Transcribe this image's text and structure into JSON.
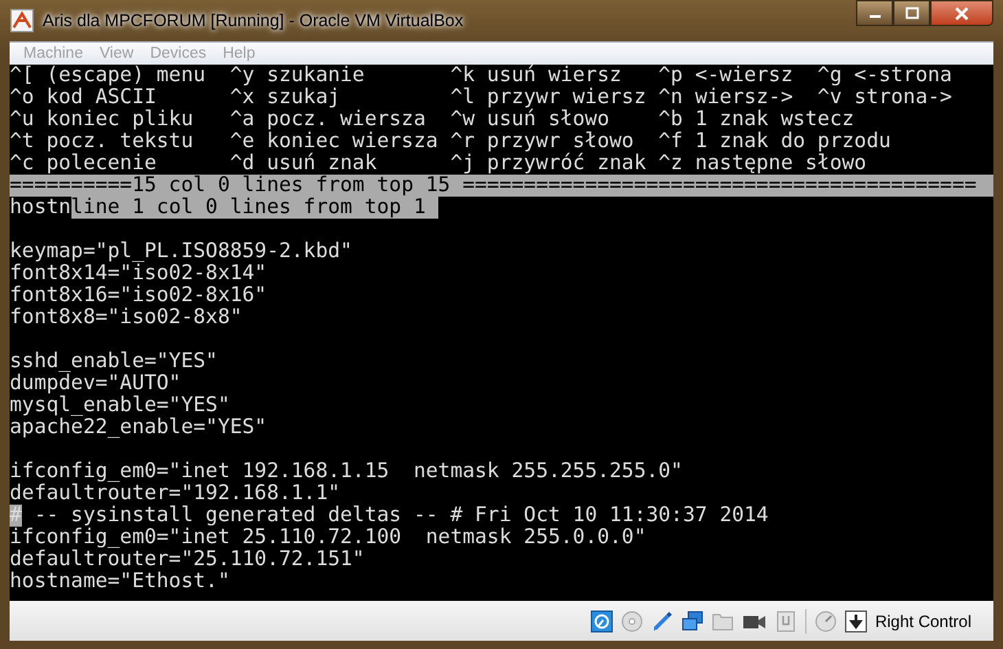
{
  "window": {
    "title": "Aris dla MPCFORUM [Running] - Oracle VM VirtualBox"
  },
  "menu": [
    {
      "label": "Machine",
      "disabled": true
    },
    {
      "label": "View",
      "disabled": true
    },
    {
      "label": "Devices",
      "disabled": true
    },
    {
      "label": "Help",
      "disabled": true
    }
  ],
  "terminal": {
    "help_rows": [
      [
        "^[ (escape) menu",
        "^y szukanie",
        "^k usuń wiersz",
        "^p <-wiersz",
        "^g <-strona"
      ],
      [
        "^o kod ASCII",
        "^x szukaj",
        "^l przywr wiersz",
        "^n wiersz->",
        "^v strona->"
      ],
      [
        "^u koniec pliku",
        "^a pocz. wiersza",
        "^w usuń słowo",
        "^b 1 znak wstecz"
      ],
      [
        "^t pocz. tekstu",
        "^e koniec wiersza",
        "^r przywr słowo",
        "^f 1 znak do przodu"
      ],
      [
        "^c polecenie",
        "^d usuń znak",
        "^j przywróć znak",
        "^z następne słowo"
      ]
    ],
    "status_line": "==========15 col 0 lines from top 15 ==========================================",
    "prompt_line": {
      "typed": "hostn",
      "message": "line 1 col 0 lines from top 1 "
    },
    "blocks": [
      [
        {
          "text": "keymap=\"pl_PL.ISO8859-2.kbd\"",
          "cursor": false
        },
        {
          "text": "font8x14=\"iso02-8x14\"",
          "cursor": false
        },
        {
          "text": "font8x16=\"iso02-8x16\"",
          "cursor": false
        },
        {
          "text": "font8x8=\"iso02-8x8\"",
          "cursor": false
        }
      ],
      [
        {
          "text": "sshd_enable=\"YES\"",
          "cursor": false
        },
        {
          "text": "dumpdev=\"AUTO\"",
          "cursor": false
        },
        {
          "text": "mysql_enable=\"YES\"",
          "cursor": false
        },
        {
          "text": "apache22_enable=\"YES\"",
          "cursor": false
        }
      ],
      [
        {
          "text": "ifconfig_em0=\"inet 192.168.1.15  netmask 255.255.255.0\"",
          "cursor": false
        },
        {
          "text": "defaultrouter=\"192.168.1.1\"",
          "cursor": false
        },
        {
          "text": "# -- sysinstall generated deltas -- # Fri Oct 10 11:30:37 2014",
          "cursor": true
        },
        {
          "text": "ifconfig_em0=\"inet 25.110.72.100  netmask 255.0.0.0\"",
          "cursor": false
        },
        {
          "text": "defaultrouter=\"25.110.72.151\"",
          "cursor": false
        },
        {
          "text": "hostname=\"Ethost.\"",
          "cursor": false
        }
      ]
    ]
  },
  "status_bar": {
    "host_key": "Right Control"
  }
}
